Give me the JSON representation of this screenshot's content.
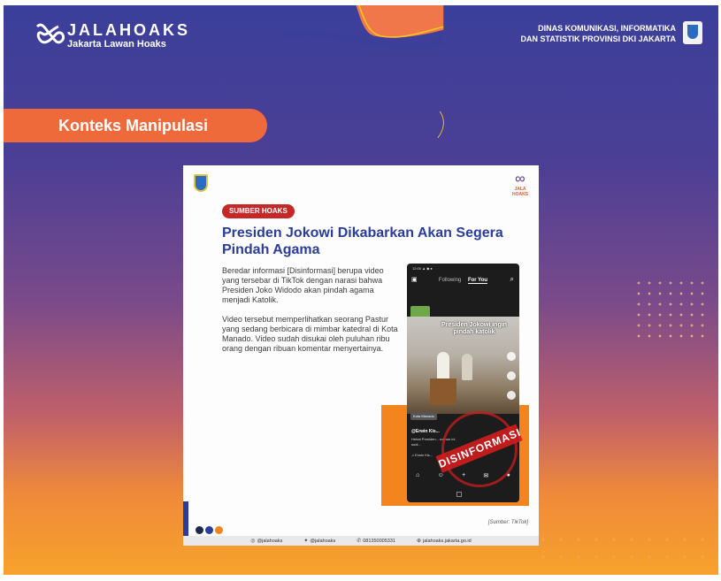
{
  "header": {
    "brand_title": "JALAHOAKS",
    "brand_subtitle": "Jakarta Lawan Hoaks",
    "dept_line1": "DINAS KOMUNIKASI, INFORMATIKA",
    "dept_line2": "DAN STATISTIK PROVINSI DKI JAKARTA"
  },
  "section_label": "Konteks Manipulasi",
  "card": {
    "badge": "SUMBER HOAKS",
    "logo_text": "JALA HOAKS",
    "headline": "Presiden Jokowi Dikabarkan Akan Segera Pindah Agama",
    "para1": "Beredar informasi [Disinformasi] berupa video yang tersebar di TikTok dengan narasi bahwa Presiden Joko Widodo akan pindah agama menjadi Katolik.",
    "para2": "Video tersebut memperlihatkan seorang Pastur yang sedang berbicara di mimbar katedral di Kota Manado. Video sudah disukai oleh puluhan ribu orang dengan ribuan komentar menyertainya.",
    "source": "[Sumber: TikTok]",
    "stamp": "DISINFORMASI",
    "phone": {
      "tab_following": "Following",
      "tab_foryou": "For You",
      "caption": "Presiden Jokowi ingin pindah katolik",
      "location": "Kota Manado",
      "username": "@Erwin Kis...",
      "desc": "Hebat Presiden... namun ini sudi...",
      "music": "♫  Erwin Kis..."
    },
    "footer": {
      "instagram": "@jalahoaks",
      "twitter": "@jalahoaks",
      "whatsapp": "081350005331",
      "website": "jalahoaks.jakarta.go.id"
    }
  },
  "colors": {
    "orange": "#ef6a3a",
    "navy": "#2a3d9c",
    "stamp_red": "#d21e1e",
    "gold_wave": "#f6c324"
  },
  "icons": [
    "jalahoaks-logo-icon",
    "dki-crest-icon",
    "instagram-icon",
    "twitter-icon",
    "whatsapp-icon",
    "globe-icon",
    "search-icon",
    "home-icon"
  ]
}
